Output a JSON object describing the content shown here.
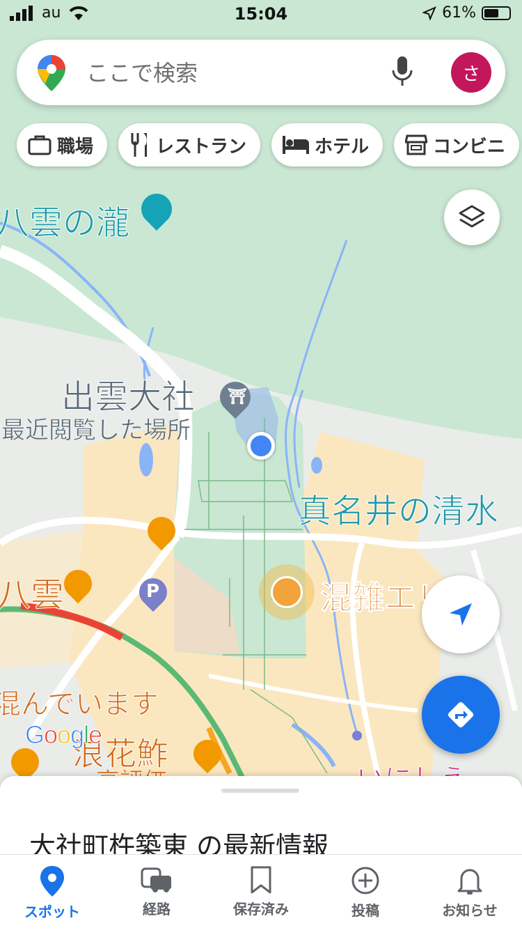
{
  "status": {
    "carrier": "au",
    "time": "15:04",
    "battery": "61%"
  },
  "search": {
    "placeholder": "ここで検索",
    "avatar_letter": "さ"
  },
  "chips": [
    {
      "label": "職場",
      "icon": "briefcase-icon"
    },
    {
      "label": "レストラン",
      "icon": "utensils-icon"
    },
    {
      "label": "ホテル",
      "icon": "bed-icon"
    },
    {
      "label": "コンビニ",
      "icon": "store-icon"
    }
  ],
  "map": {
    "labels": {
      "yakumo_falls": "八雲の瀧",
      "izumo_taisha": "出雲大社",
      "recent": "最近閲覧した場所",
      "manai_spring": "真名井の清水",
      "yakumo": "八雲",
      "crowded_area": "混雑エリア",
      "busy": "混んでいます",
      "namihana": "浪花鮓",
      "rating": "高評価",
      "partial_right": "いにしえ"
    },
    "colors": {
      "park": "#c9e7d3",
      "water": "#8ab4f8",
      "commercial": "#fbe7bf",
      "road": "#ffffff",
      "accent": "#1a73e8"
    }
  },
  "google_logo": {
    "letters": [
      "G",
      "o",
      "o",
      "g",
      "l",
      "e"
    ]
  },
  "sheet": {
    "title": "大社町杵築東 の最新情報"
  },
  "nav": [
    {
      "label": "スポット",
      "icon": "pin-icon",
      "active": true
    },
    {
      "label": "経路",
      "icon": "car-icon",
      "active": false
    },
    {
      "label": "保存済み",
      "icon": "bookmark-icon",
      "active": false
    },
    {
      "label": "投稿",
      "icon": "plus-circle-icon",
      "active": false
    },
    {
      "label": "お知らせ",
      "icon": "bell-icon",
      "active": false
    }
  ]
}
